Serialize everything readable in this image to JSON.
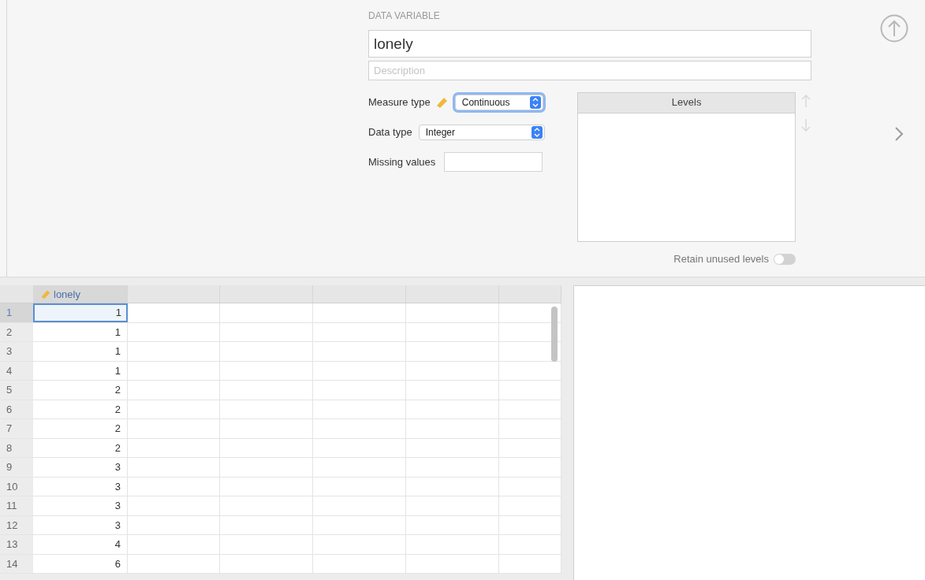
{
  "variable_panel": {
    "heading": "DATA VARIABLE",
    "name": "lonely",
    "description_placeholder": "Description",
    "measure_type": {
      "label": "Measure type",
      "value": "Continuous",
      "focused": true
    },
    "data_type": {
      "label": "Data type",
      "value": "Integer"
    },
    "missing_values": {
      "label": "Missing values"
    },
    "levels": {
      "header": "Levels"
    },
    "retain_unused_levels": {
      "label": "Retain unused levels",
      "on": false
    }
  },
  "table": {
    "columns": [
      {
        "name": "lonely",
        "kind": "continuous"
      }
    ],
    "rows": [
      {
        "number": "1",
        "values": [
          "1"
        ],
        "selected": true
      },
      {
        "number": "2",
        "values": [
          "1"
        ],
        "selected": false
      },
      {
        "number": "3",
        "values": [
          "1"
        ],
        "selected": false
      },
      {
        "number": "4",
        "values": [
          "1"
        ],
        "selected": false
      },
      {
        "number": "5",
        "values": [
          "2"
        ],
        "selected": false
      },
      {
        "number": "6",
        "values": [
          "2"
        ],
        "selected": false
      },
      {
        "number": "7",
        "values": [
          "2"
        ],
        "selected": false
      },
      {
        "number": "8",
        "values": [
          "2"
        ],
        "selected": false
      },
      {
        "number": "9",
        "values": [
          "3"
        ],
        "selected": false
      },
      {
        "number": "10",
        "values": [
          "3"
        ],
        "selected": false
      },
      {
        "number": "11",
        "values": [
          "3"
        ],
        "selected": false
      },
      {
        "number": "12",
        "values": [
          "3"
        ],
        "selected": false
      },
      {
        "number": "13",
        "values": [
          "4"
        ],
        "selected": false
      },
      {
        "number": "14",
        "values": [
          "6"
        ],
        "selected": false
      }
    ]
  }
}
